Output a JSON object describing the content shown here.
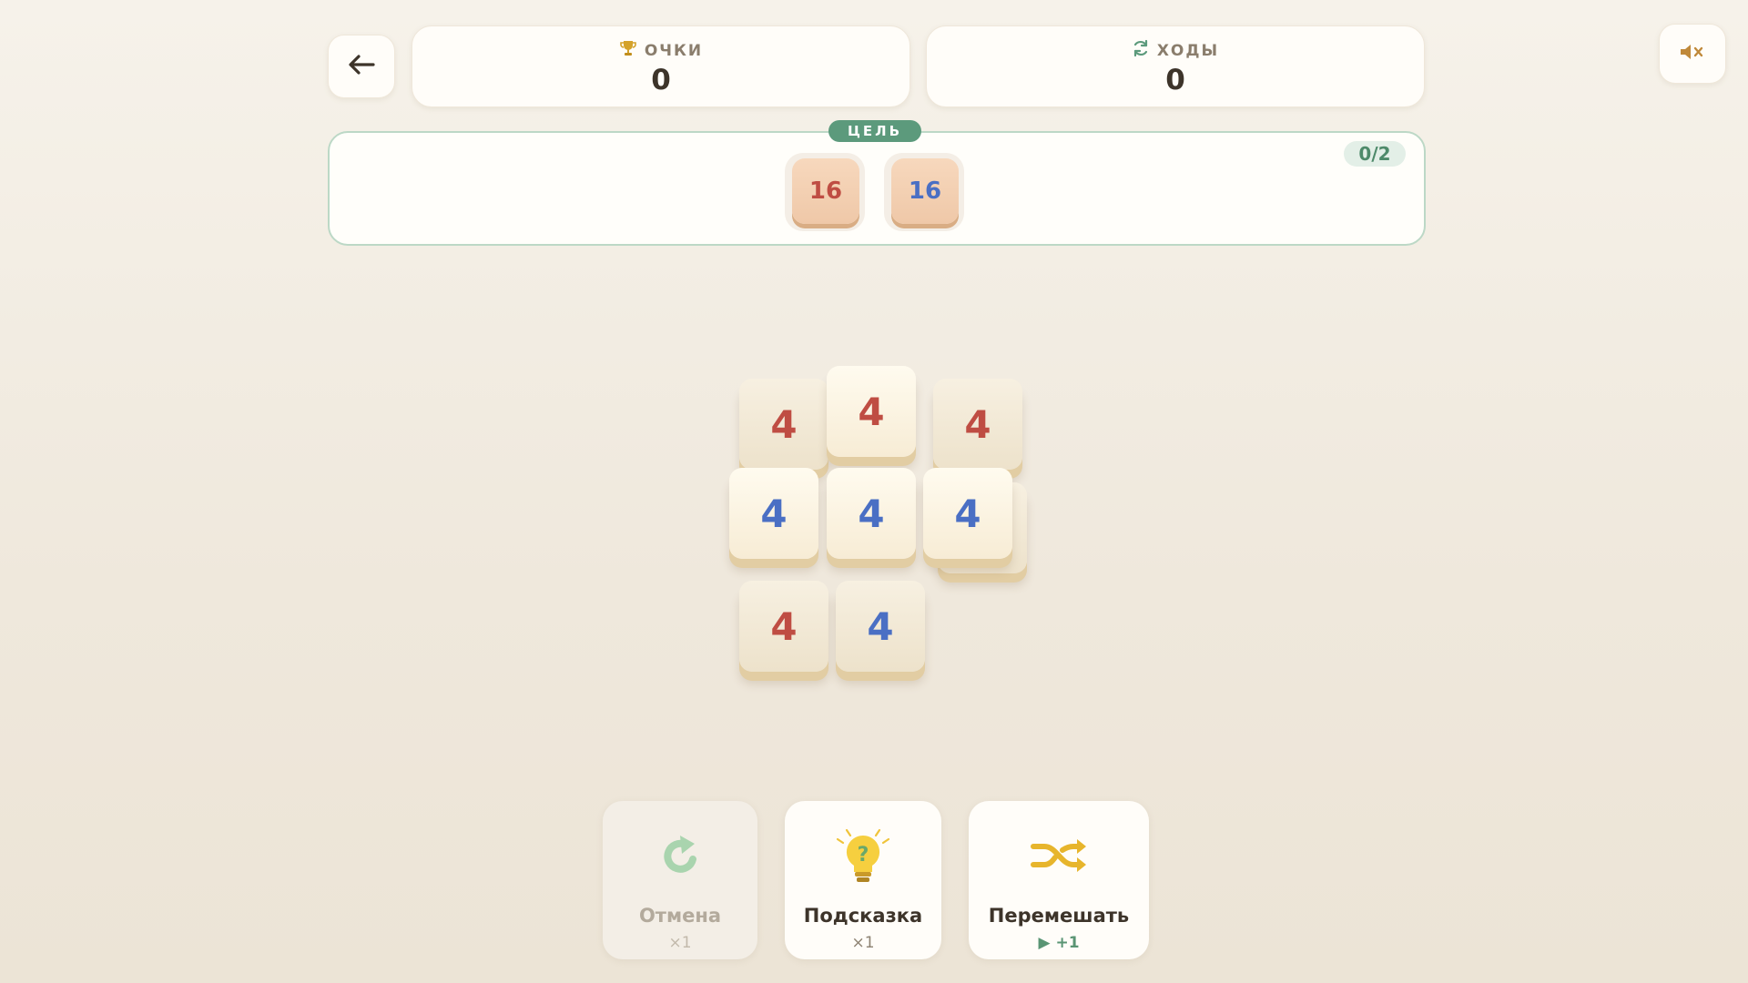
{
  "header": {
    "back_icon": "arrow-left-icon",
    "score": {
      "icon": "trophy-icon",
      "label": "ОЧКИ",
      "value": "0"
    },
    "moves": {
      "icon": "refresh-icon",
      "label": "ХОДЫ",
      "value": "0"
    },
    "sound_icon": "speaker-muted-icon"
  },
  "goal": {
    "badge": "ЦЕЛЬ",
    "progress": "0/2",
    "tiles": [
      {
        "value": "16",
        "color": "red"
      },
      {
        "value": "16",
        "color": "blue"
      }
    ]
  },
  "board": {
    "tiles": [
      {
        "value": "4",
        "color": "red"
      },
      {
        "value": "4",
        "color": "red"
      },
      {
        "value": "4",
        "color": "red"
      },
      {
        "value": "4",
        "color": "blue"
      },
      {
        "value": "4",
        "color": "blue"
      },
      {
        "value": "4",
        "color": "blue"
      },
      {
        "value": "4",
        "color": "red"
      },
      {
        "value": "4",
        "color": "blue"
      }
    ]
  },
  "actions": {
    "undo": {
      "label": "Отмена",
      "sub": "×1",
      "icon": "undo-arrow-icon",
      "enabled": false
    },
    "hint": {
      "label": "Подсказка",
      "sub": "×1",
      "icon": "lightbulb-question-icon"
    },
    "shuffle": {
      "label": "Перемешать",
      "sub": "▶ +1",
      "icon": "shuffle-icon"
    }
  },
  "colors": {
    "red_tile_text": "#bf4d43",
    "blue_tile_text": "#4a6fc4",
    "goal_accent": "#5c9a7c",
    "background": "#f3eee5"
  }
}
